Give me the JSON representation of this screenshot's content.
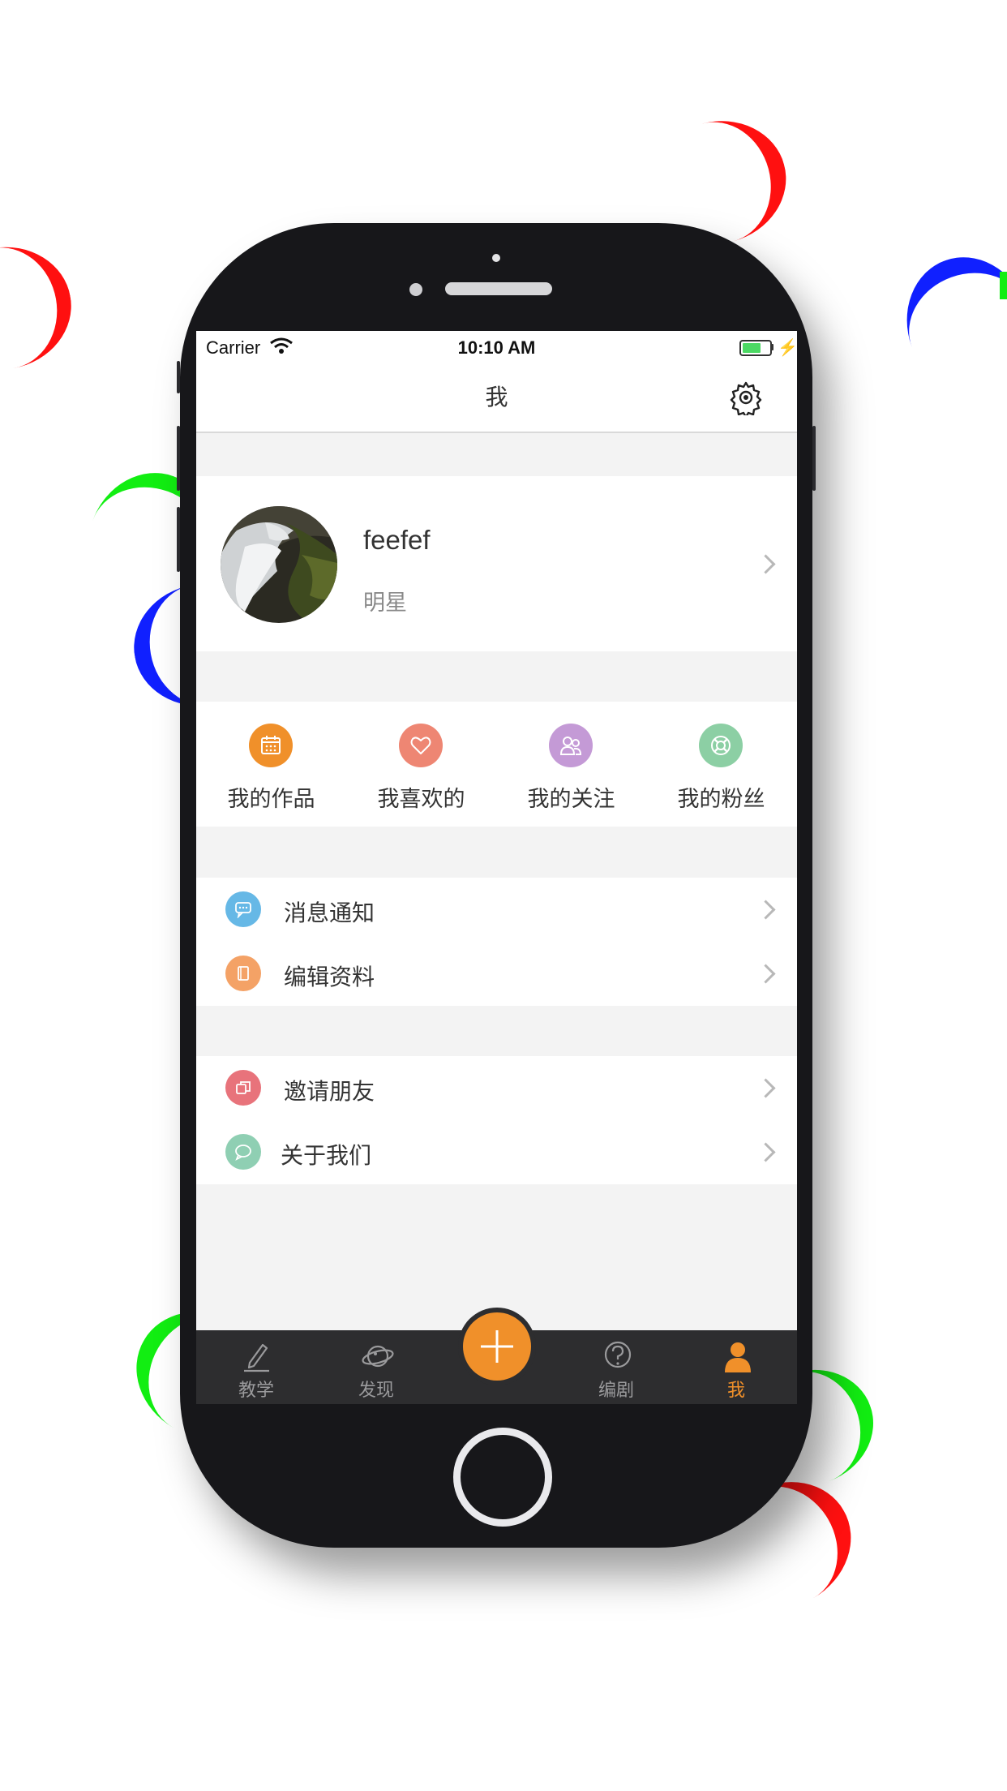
{
  "status_bar": {
    "carrier": "Carrier",
    "time": "10:10 AM"
  },
  "nav": {
    "title": "我",
    "settings_icon": "gear-icon"
  },
  "profile": {
    "name": "feefef",
    "tag": "明星",
    "avatar": "waterfall-photo"
  },
  "quick_actions": [
    {
      "label": "我的作品",
      "icon": "calendar-icon",
      "color": "#f0902a"
    },
    {
      "label": "我喜欢的",
      "icon": "heart-icon",
      "color": "#ee8673"
    },
    {
      "label": "我的关注",
      "icon": "people-icon",
      "color": "#c49ad6"
    },
    {
      "label": "我的粉丝",
      "icon": "lifebuoy-icon",
      "color": "#8ccfa4"
    }
  ],
  "menu_group_1": [
    {
      "label": "消息通知",
      "icon": "message-icon",
      "color": "#66b8e6"
    },
    {
      "label": "编辑资料",
      "icon": "edit-doc-icon",
      "color": "#f4a266"
    }
  ],
  "menu_group_2": [
    {
      "label": "邀请朋友",
      "icon": "copy-icon",
      "color": "#e8737b"
    },
    {
      "label": "关于我们",
      "icon": "chat-bubble-icon",
      "color": "#8fcfb3"
    }
  ],
  "tab_bar": {
    "tabs": [
      {
        "label": "教学",
        "icon": "pencil-icon",
        "active": false
      },
      {
        "label": "发现",
        "icon": "planet-icon",
        "active": false
      },
      {
        "label": "",
        "icon": "plus-icon",
        "active": false
      },
      {
        "label": "编剧",
        "icon": "question-icon",
        "active": false
      },
      {
        "label": "我",
        "icon": "person-icon",
        "active": true
      }
    ],
    "active_color": "#f0902a",
    "inactive_color": "#9a9a9c"
  }
}
